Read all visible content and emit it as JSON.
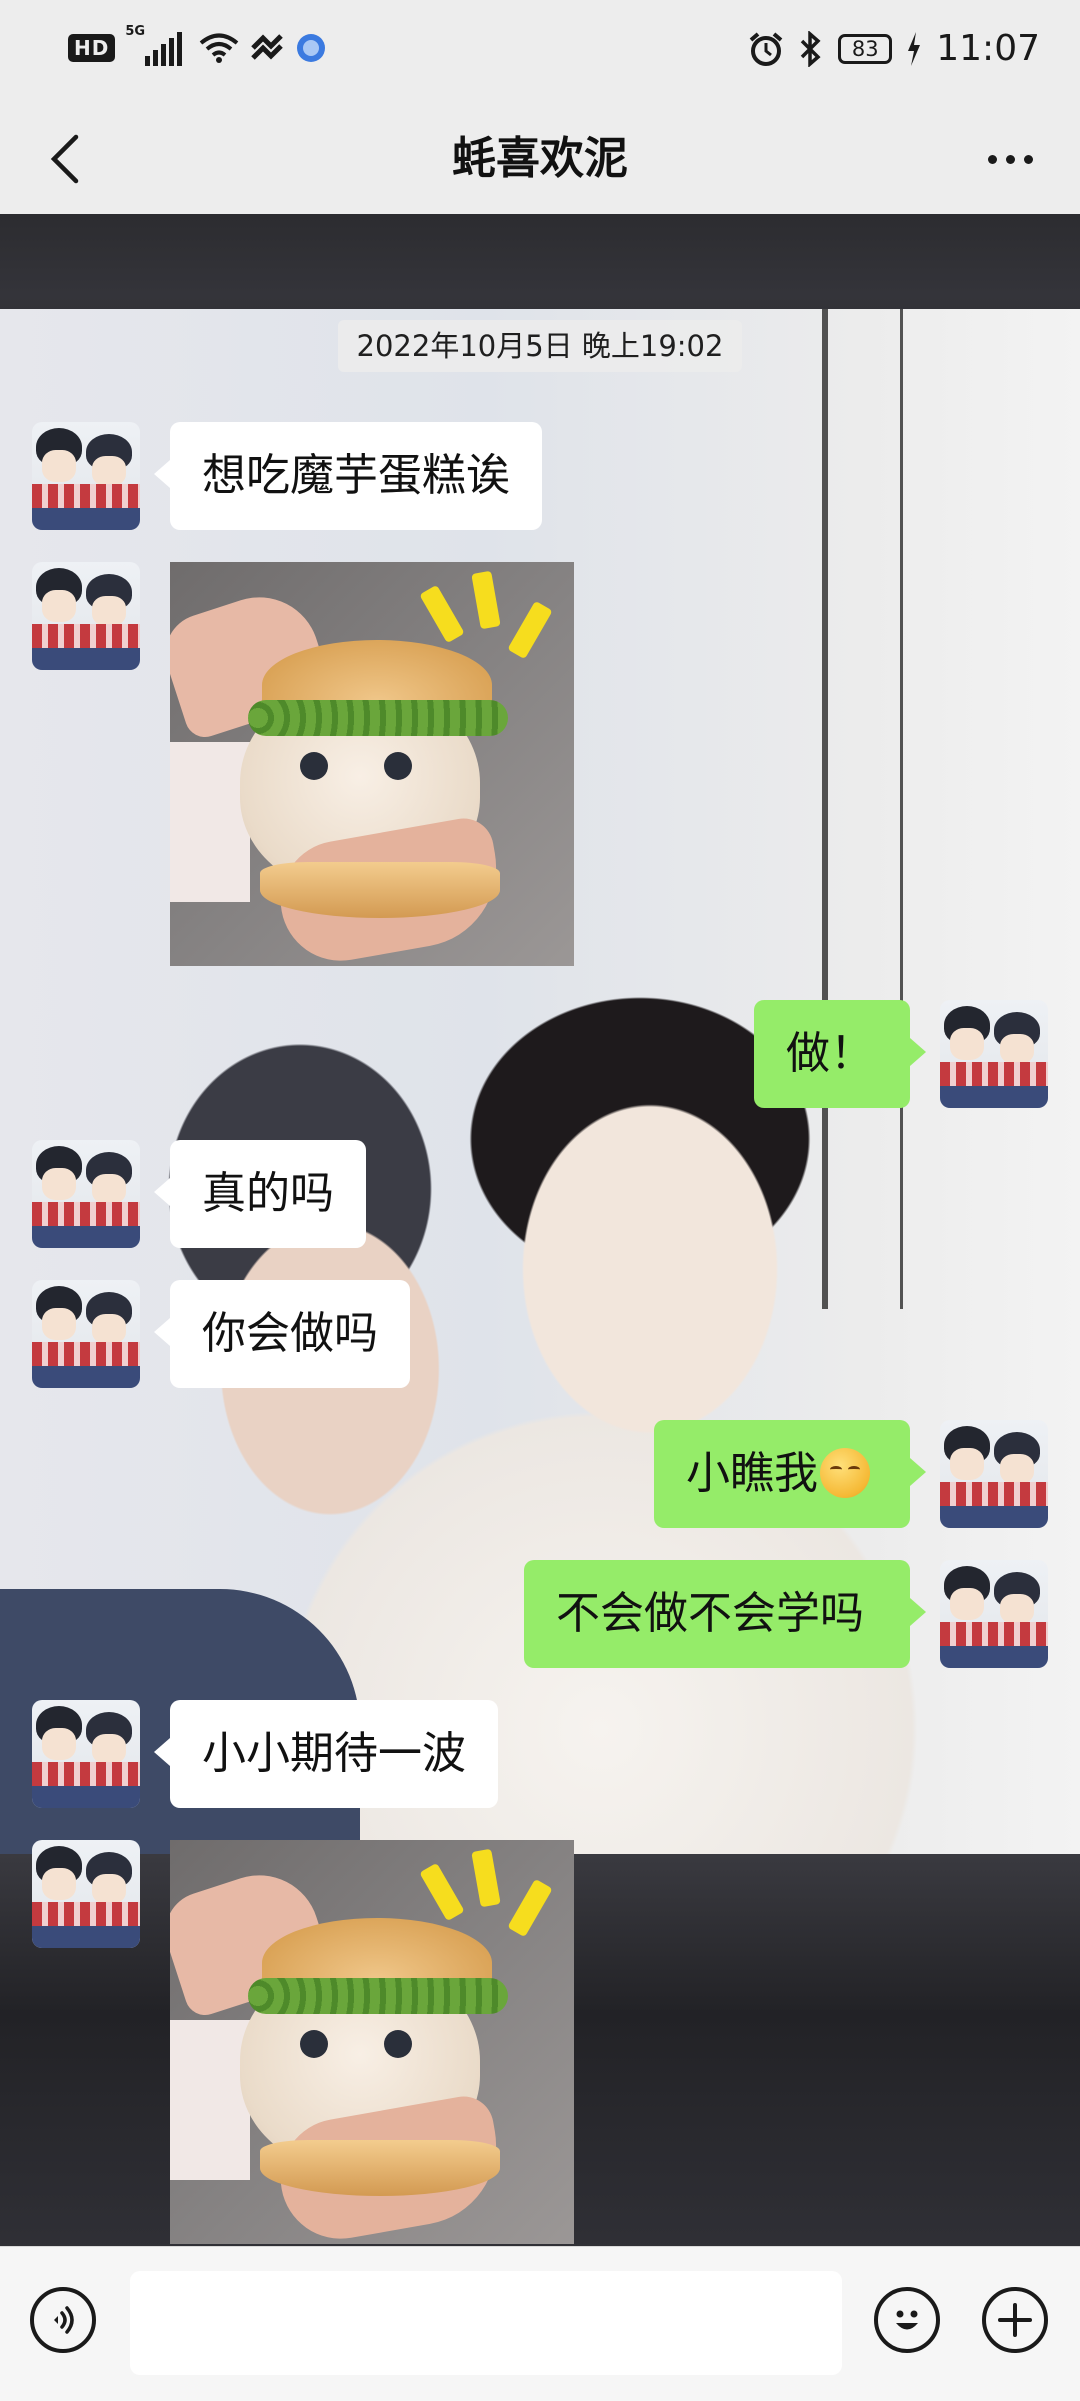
{
  "status_bar": {
    "hd_badge": "HD",
    "network": "5G",
    "battery": "83",
    "time": "11:07",
    "icons": [
      "signal-icon",
      "wifi-icon",
      "link-icon",
      "app-icon",
      "alarm-icon",
      "bluetooth-icon",
      "battery-icon",
      "charging-icon"
    ]
  },
  "header": {
    "title": "蚝喜欢泥",
    "back_icon": "chevron-left-icon",
    "more_icon": "more-dots-icon"
  },
  "chat": {
    "timestamp": "2022年10月5日 晚上19:02",
    "messages": [
      {
        "side": "in",
        "type": "text",
        "text": "想吃魔芋蛋糕诶"
      },
      {
        "side": "in",
        "type": "sticker",
        "sticker": "cat-burger-sticker"
      },
      {
        "side": "out",
        "type": "text",
        "text": "做！"
      },
      {
        "side": "in",
        "type": "text",
        "text": "真的吗"
      },
      {
        "side": "in",
        "type": "text",
        "text": "你会做吗"
      },
      {
        "side": "out",
        "type": "text",
        "text": "小瞧我",
        "emoji": "kissing-face-emoji"
      },
      {
        "side": "out",
        "type": "text",
        "text": "不会做不会学吗"
      },
      {
        "side": "in",
        "type": "text",
        "text": "小小期待一波"
      },
      {
        "side": "in",
        "type": "sticker",
        "sticker": "cat-burger-sticker"
      }
    ]
  },
  "input_bar": {
    "voice_icon": "voice-icon",
    "emoji_icon": "emoji-icon",
    "plus_icon": "plus-icon",
    "placeholder": ""
  },
  "colors": {
    "outgoing_bubble": "#95ec69",
    "incoming_bubble": "#ffffff",
    "bar_background": "#ededed"
  }
}
